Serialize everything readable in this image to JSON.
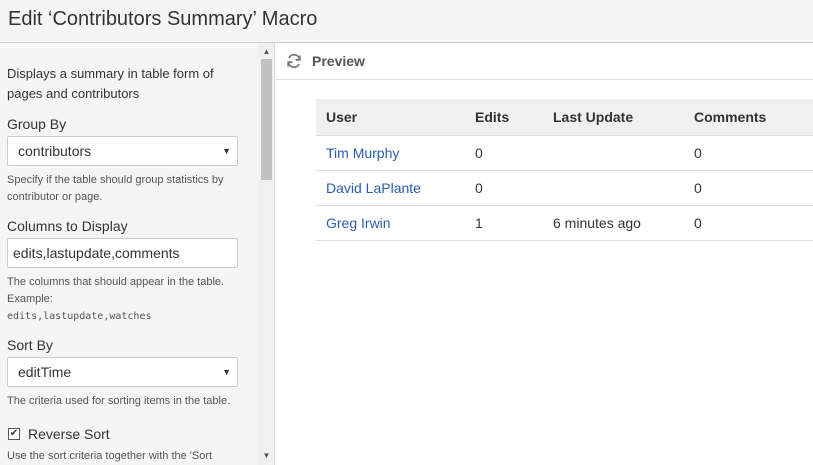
{
  "header": {
    "title": "Edit ‘Contributors Summary’ Macro"
  },
  "form": {
    "description": "Displays a summary in table form of pages and contributors",
    "group_by": {
      "label": "Group By",
      "value": "contributors",
      "help": "Specify if the table should group statistics by contributor or page."
    },
    "columns": {
      "label": "Columns to Display",
      "value": "edits,lastupdate,comments",
      "help": "The columns that should appear in the table. Example:",
      "example": "edits,lastupdate,watches"
    },
    "sort_by": {
      "label": "Sort By",
      "value": "editTime",
      "help": "The criteria used for sorting items in the table."
    },
    "reverse_sort": {
      "label": "Reverse Sort",
      "checked": true,
      "help_cut": "Use the sort criteria together with the 'Sort"
    }
  },
  "preview": {
    "label": "Preview",
    "table": {
      "headers": [
        "User",
        "Edits",
        "Last Update",
        "Comments"
      ],
      "rows": [
        {
          "user": "Tim Murphy",
          "edits": "0",
          "last_update": "",
          "comments": "0"
        },
        {
          "user": "David LaPlante",
          "edits": "0",
          "last_update": "",
          "comments": "0"
        },
        {
          "user": "Greg Irwin",
          "edits": "1",
          "last_update": "6 minutes ago",
          "comments": "0"
        }
      ]
    }
  },
  "colors": {
    "link": "#2a5db0",
    "header_bg": "#f5f5f5",
    "table_header_bg": "#f0f0f0"
  },
  "icons": {
    "refresh": "refresh-icon",
    "dropdown": "chevron-down-icon",
    "checkbox": "checkmark-icon"
  }
}
